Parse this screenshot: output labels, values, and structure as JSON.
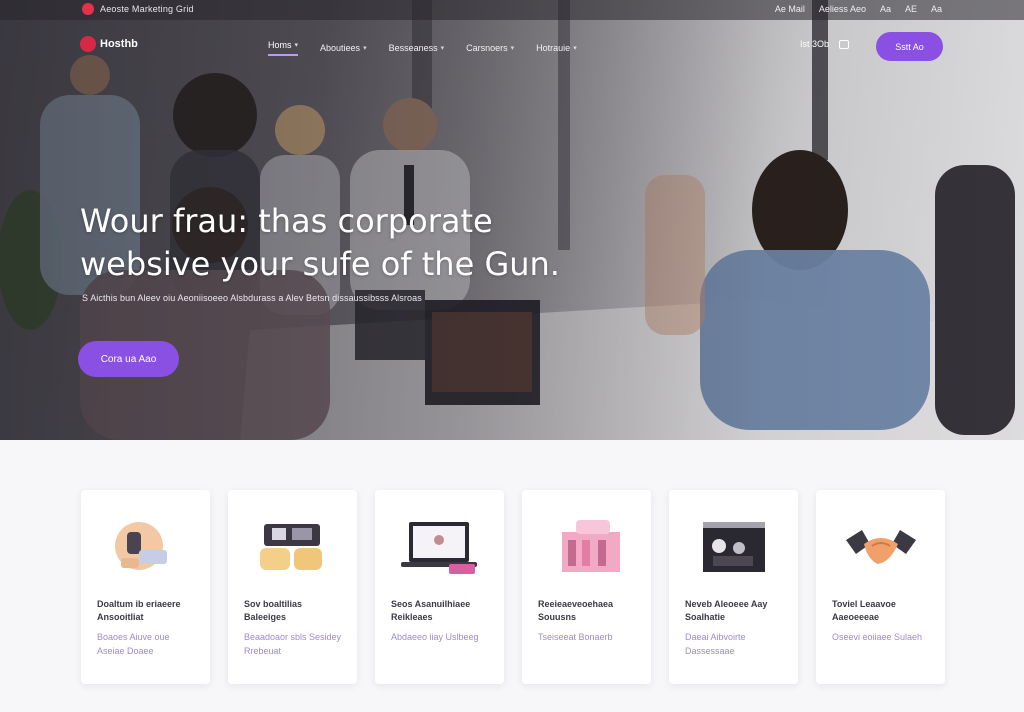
{
  "topbar": {
    "brand": "Aeoste Marketing Grid",
    "links": [
      "Ae Mail",
      "Aeliess Aeo",
      "Aa",
      "AE",
      "Aa"
    ]
  },
  "nav": {
    "logo": "Hosthb",
    "items": [
      {
        "label": "Homs",
        "active": true
      },
      {
        "label": "Aboutiees"
      },
      {
        "label": "Besseaness"
      },
      {
        "label": "Carsnoers"
      },
      {
        "label": "Hotrauie"
      }
    ],
    "right_text": "Ist 3Ob",
    "button": "Sstt Ao"
  },
  "hero": {
    "headline_line1": "Wour frau: thas corporate",
    "headline_line2": "websive your sufe of the Gun.",
    "subline": "S Aicthis bun Aleev oiu Aeoniisoeeo Alsbdurass a Alev Betsn dissaussibsss Alsroas",
    "cta": "Cora ua Aao"
  },
  "cards": [
    {
      "title": "Doaltum ib eriaeere Ansooitliat",
      "desc": "Boaoes Aiuve oue Aseiae Doaee",
      "icon": "meeting-illustration-icon"
    },
    {
      "title": "Sov boaltilias Baleeiges",
      "desc": "Beaadoaor sbls Sesidey Rrebeuat",
      "icon": "team-work-illustration-icon"
    },
    {
      "title": "Seos Asanuilhiaee Reikleaes",
      "desc": "Abdaeeo iiay Uslbeeg",
      "icon": "laptop-illustration-icon"
    },
    {
      "title": "Reeieaeveoehaea Souusns",
      "desc": "Tseiseeat Bonaerb",
      "icon": "building-illustration-icon"
    },
    {
      "title": "Neveb Aleoeee Aay Soalhatie",
      "desc": "Daeai Aibvoirte Dassessaae",
      "icon": "office-screen-illustration-icon"
    },
    {
      "title": "Toviel Leaavoe Aaeoeeeae",
      "desc": "Oseevi eoiiaee Sulaeh",
      "icon": "handshake-icon"
    }
  ],
  "colors": {
    "accent": "#8a4fe3",
    "brand_red": "#d92845",
    "card_desc": "#9b8cc8"
  }
}
